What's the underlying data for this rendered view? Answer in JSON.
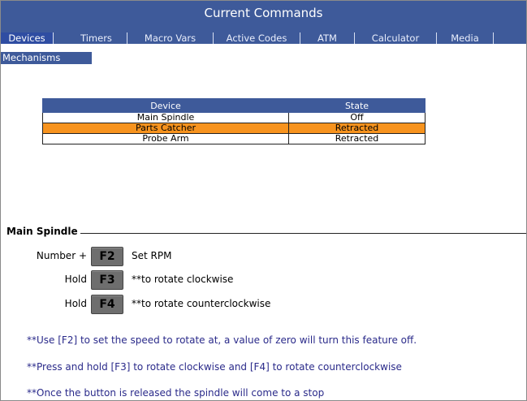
{
  "window": {
    "title": "Current Commands"
  },
  "tabs": [
    {
      "label": "Devices",
      "active": true
    },
    {
      "label": "Timers",
      "active": false
    },
    {
      "label": "Macro Vars",
      "active": false
    },
    {
      "label": "Active Codes",
      "active": false
    },
    {
      "label": "ATM",
      "active": false
    },
    {
      "label": "Calculator",
      "active": false
    },
    {
      "label": "Media",
      "active": false
    }
  ],
  "subtabs": [
    {
      "label": "Mechanisms",
      "active": true
    }
  ],
  "device_table": {
    "headers": [
      "Device",
      "State"
    ],
    "rows": [
      {
        "device": "Main Spindle",
        "state": "Off",
        "selected": false
      },
      {
        "device": "Parts Catcher",
        "state": "Retracted",
        "selected": true
      },
      {
        "device": "Probe Arm",
        "state": "Retracted",
        "selected": false
      }
    ]
  },
  "selected_colors": {
    "highlight": "#f7931e",
    "header": "#3e5a9a"
  },
  "group": {
    "title": "Main Spindle",
    "keys": [
      {
        "prefix": "Number +",
        "key": "F2",
        "desc": "Set RPM"
      },
      {
        "prefix": "Hold",
        "key": "F3",
        "desc": "**to rotate clockwise"
      },
      {
        "prefix": "Hold",
        "key": "F4",
        "desc": "**to rotate counterclockwise"
      }
    ],
    "notes": [
      "**Use [F2] to set the speed to rotate at, a value of zero will turn this feature off.",
      "**Press and hold [F3] to rotate clockwise and [F4] to rotate counterclockwise",
      "**Once the button is released the spindle will come to a stop"
    ]
  }
}
